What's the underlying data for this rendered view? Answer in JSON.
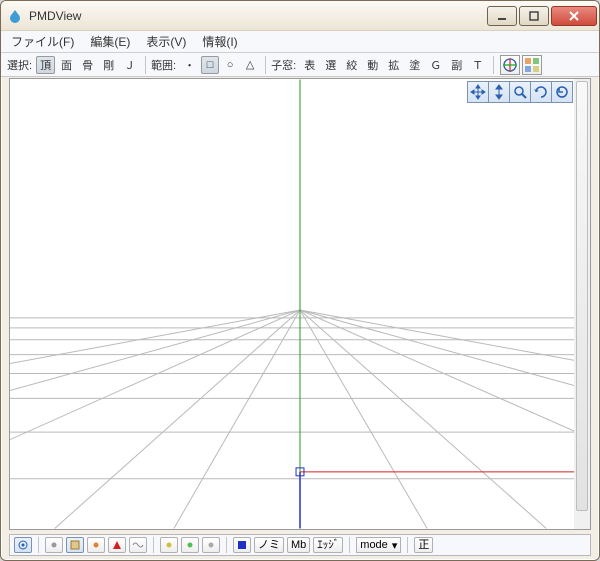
{
  "window": {
    "title": "PMDView"
  },
  "menu": {
    "file": "ファイル(F)",
    "edit": "編集(E)",
    "view": "表示(V)",
    "info": "情報(I)"
  },
  "toolbar": {
    "select_label": "選択:",
    "sel_vertex": "頂",
    "sel_face": "面",
    "sel_bone": "骨",
    "sel_rigid": "剛",
    "sel_j": "Ｊ",
    "range_label": "範囲:",
    "range_dot": "・",
    "range_rect": "□",
    "range_circle": "○",
    "range_tri": "△",
    "child_label": "子窓:",
    "cw_show": "表",
    "cw_sel": "選",
    "cw_narrow": "絞",
    "cw_move": "動",
    "cw_scale": "拡",
    "cw_paint": "塗",
    "cw_g": "Ｇ",
    "cw_sub": "副",
    "cw_t": "Ｔ"
  },
  "float_tools": {
    "move_xy": "move-xy",
    "move_z": "move-z",
    "zoom": "zoom",
    "orbit": "orbit",
    "reset": "reset"
  },
  "viewport": {
    "grid": true,
    "axes": {
      "x": "red",
      "y": "green",
      "z": "blue"
    }
  },
  "statusbar": {
    "paint_no": "ノミ",
    "mb": "Mb",
    "edge": "ｴｯｼﾞ",
    "mode_label": "mode",
    "front": "正"
  }
}
